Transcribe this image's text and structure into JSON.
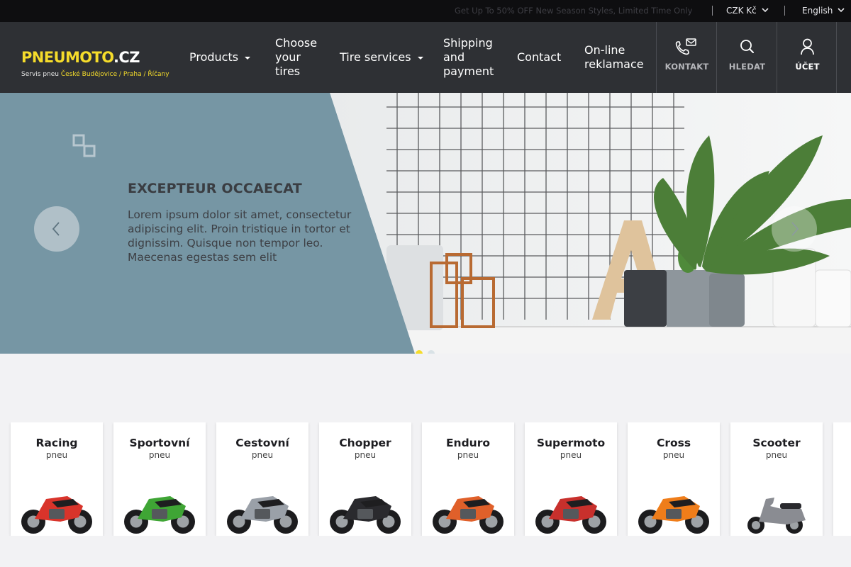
{
  "topbar": {
    "promo": "Get Up To 50% OFF New Season Styles, Limited Time Only",
    "currency": "CZK Kč",
    "language": "English"
  },
  "header": {
    "logo_main": "PNEUMOTO",
    "logo_tld": ".CZ",
    "logo_sub_prefix": "Servis pneu",
    "logo_sub_cities": "České Budějovice / Praha / Říčany",
    "nav": {
      "products": "Products",
      "choose": "Choose\nyour\ntires",
      "tire_services": "Tire services",
      "shipping": "Shipping\nand\npayment",
      "contact": "Contact",
      "reklamace": "On-line\nreklamace"
    },
    "buttons": {
      "kontakt": "KONTAKT",
      "hledat": "HLEDAT",
      "ucet": "ÚČET"
    }
  },
  "hero": {
    "title": "EXCEPTEUR OCCAECAT",
    "text": "Lorem ipsum dolor sit amet, consectetur adipiscing elit. Proin tristique in tortor et dignissim. Quisque non tempor leo. Maecenas egestas sem elit",
    "slide_count": 2,
    "active_slide": 1
  },
  "categories": [
    {
      "title": "Racing",
      "sub": "pneu",
      "bike_color": "#d9342b"
    },
    {
      "title": "Sportovní",
      "sub": "pneu",
      "bike_color": "#3fa535"
    },
    {
      "title": "Cestovní",
      "sub": "pneu",
      "bike_color": "#9aa0a8"
    },
    {
      "title": "Chopper",
      "sub": "pneu",
      "bike_color": "#2a2a2e"
    },
    {
      "title": "Enduro",
      "sub": "pneu",
      "bike_color": "#e0602a"
    },
    {
      "title": "Supermoto",
      "sub": "pneu",
      "bike_color": "#c8302c"
    },
    {
      "title": "Cross",
      "sub": "pneu",
      "bike_color": "#ef7d1a"
    },
    {
      "title": "Scooter",
      "sub": "pneu",
      "bike_color": "#8a8c92"
    }
  ],
  "colors": {
    "brand_yellow": "#f5dc2b",
    "header_bg": "#2e3034",
    "hero_panel": "#7696a4"
  }
}
